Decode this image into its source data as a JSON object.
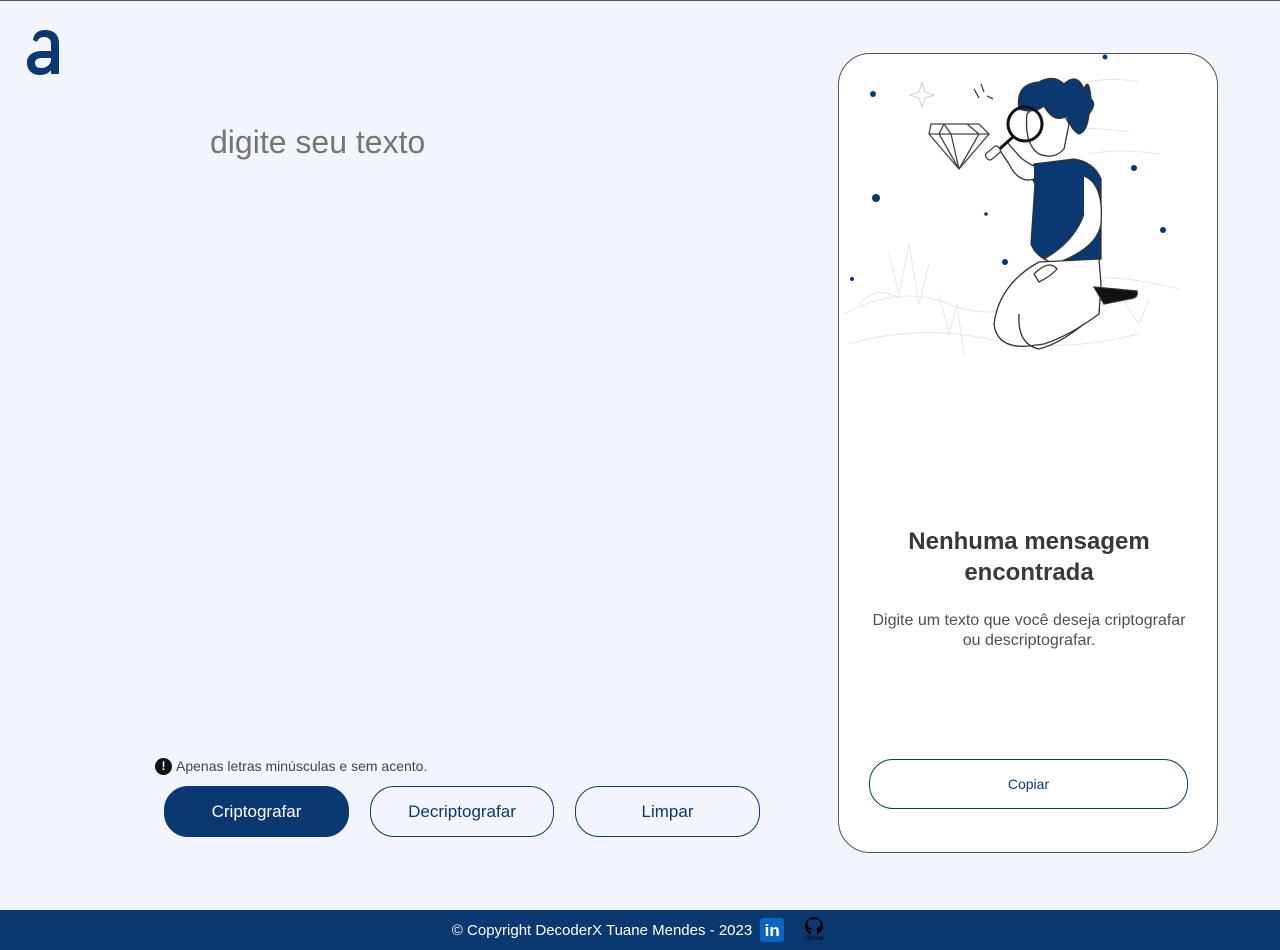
{
  "textarea": {
    "placeholder": "digite seu texto"
  },
  "warning": {
    "icon": "exclamation-icon",
    "text": "Apenas letras minúsculas e sem acento."
  },
  "buttons": {
    "encrypt": "Criptografar",
    "decrypt": "Decriptografar",
    "clear": "Limpar"
  },
  "output_panel": {
    "title": "Nenhuma mensagem encontrada",
    "message": "Digite um texto que você deseja criptografar ou descriptografar.",
    "copy_label": "Copiar"
  },
  "footer": {
    "copyright": "© Copyright DecoderX Tuane Mendes - 2023",
    "linkedin_text": "in",
    "github_label": "GitHub"
  },
  "colors": {
    "brand": "#0a3871",
    "background": "#f3f5fc",
    "panel": "#ffffff"
  }
}
